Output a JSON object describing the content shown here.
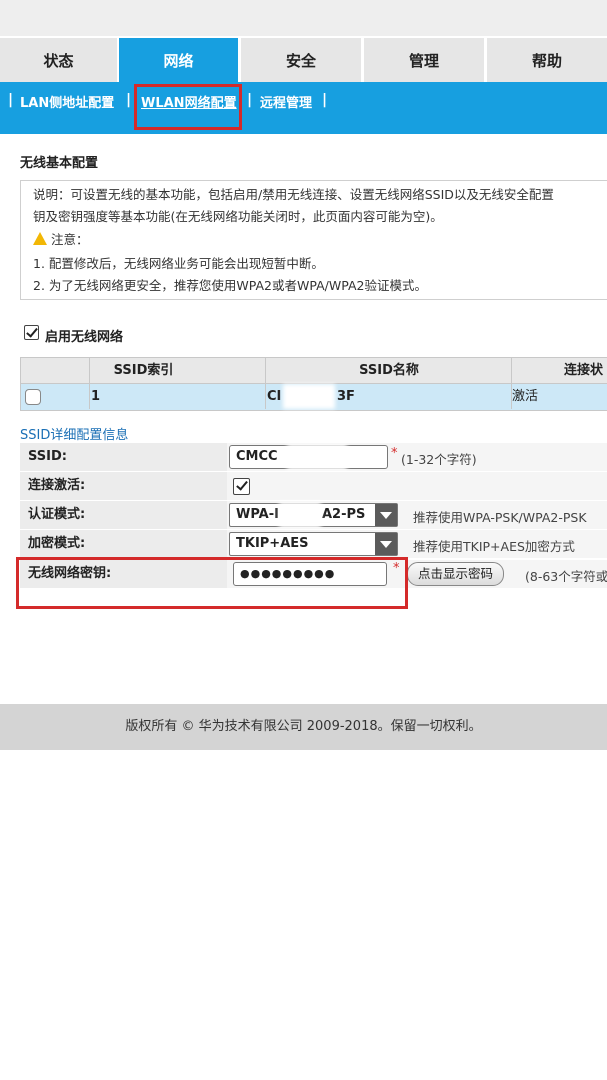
{
  "tabs": [
    {
      "label": "状态"
    },
    {
      "label": "网络"
    },
    {
      "label": "安全"
    },
    {
      "label": "管理"
    },
    {
      "label": "帮助"
    }
  ],
  "subnav": {
    "lan": "LAN侧地址配置",
    "wlan": "WLAN网络配置",
    "remote": "远程管理"
  },
  "page": {
    "section_title": "无线基本配置",
    "note": {
      "line1": "说明：可设置无线的基本功能，包括启用/禁用无线连接、设置无线网络SSID以及无线安全配置",
      "line2": "钥及密钥强度等基本功能(在无线网络功能关闭时，此页面内容可能为空)。",
      "warning": "注意：",
      "item1": "1. 配置修改后，无线网络业务可能会出现短暂中断。",
      "item2": "2. 为了无线网络更安全，推荐您使用WPA2或者WPA/WPA2验证模式。"
    },
    "enable_wifi_label": "启用无线网络",
    "enable_wifi_checked": true
  },
  "ssid_table": {
    "headers": [
      "SSID索引",
      "SSID名称",
      "连接状"
    ],
    "rows": [
      {
        "index": "1",
        "name_start": "CI",
        "name_end": "3F",
        "status": "激活"
      }
    ]
  },
  "details": {
    "title": "SSID详细配置信息",
    "ssid": {
      "label": "SSID:",
      "value": "CMCC",
      "required": "*",
      "hint": "(1-32个字符)"
    },
    "active": {
      "label": "连接激活:",
      "checked": true
    },
    "auth": {
      "label": "认证模式:",
      "value_start": "WPA-I",
      "value_end": "A2-PS",
      "hint": "推荐使用WPA-PSK/WPA2-PSK"
    },
    "encrypt": {
      "label": "加密模式:",
      "value": "TKIP+AES",
      "hint": "推荐使用TKIP+AES加密方式"
    },
    "key": {
      "label": "无线网络密钥:",
      "value": "●●●●●●●●●",
      "required": "*",
      "show_button": "点击显示密码",
      "hint": "(8-63个字符或"
    }
  },
  "footer": {
    "text": "版权所有 © 华为技术有限公司 2009-2018。保留一切权利。"
  },
  "colors": {
    "accent": "#179fe0",
    "highlight": "#d42a2a",
    "row_selected": "#cde8f7"
  }
}
